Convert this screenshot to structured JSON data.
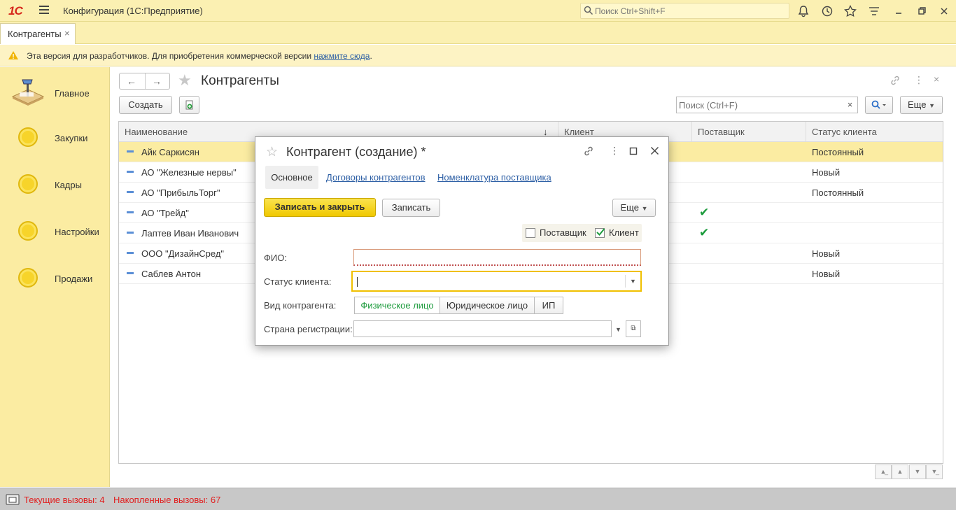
{
  "app": {
    "logo": "1С",
    "title": "Конфигурация  (1С:Предприятие)",
    "search_placeholder": "Поиск Ctrl+Shift+F"
  },
  "tabs": [
    {
      "label": "Контрагенты",
      "close": "×"
    }
  ],
  "warning": {
    "text": "Эта версия для разработчиков. Для приобретения коммерческой версии ",
    "link": "нажмите сюда",
    "suffix": "."
  },
  "sidebar": {
    "items": [
      {
        "label": "Главное",
        "icon": "desk-lamp-icon"
      },
      {
        "label": "Закупки",
        "icon": "yellow-circle-icon"
      },
      {
        "label": "Кадры",
        "icon": "yellow-circle-icon"
      },
      {
        "label": "Настройки",
        "icon": "yellow-circle-icon"
      },
      {
        "label": "Продажи",
        "icon": "yellow-circle-icon"
      }
    ]
  },
  "main": {
    "title": "Контрагенты",
    "create_label": "Создать",
    "search_placeholder": "Поиск (Ctrl+F)",
    "clear_label": "×",
    "more_label": "Еще",
    "columns": [
      "Наименование",
      "Клиент",
      "Поставщик",
      "Статус клиента"
    ],
    "sort_indicator": "↓",
    "rows": [
      {
        "name": "Айк Саркисян",
        "supplier": false,
        "status": "Постоянный",
        "selected": true
      },
      {
        "name": "АО \"Железные нервы\"",
        "supplier": false,
        "status": "Новый"
      },
      {
        "name": "АО \"ПрибыльТорг\"",
        "supplier": false,
        "status": "Постоянный"
      },
      {
        "name": "АО \"Трейд\"",
        "supplier": true,
        "status": ""
      },
      {
        "name": "Лаптев Иван Иванович",
        "supplier": true,
        "status": ""
      },
      {
        "name": "ООО \"ДизайнСред\"",
        "supplier": false,
        "status": "Новый"
      },
      {
        "name": "Саблев Антон",
        "supplier": false,
        "status": "Новый"
      }
    ]
  },
  "dialog": {
    "title": "Контрагент (создание) *",
    "tabs": [
      "Основное",
      "Договоры контрагентов",
      "Номенклатура поставщика"
    ],
    "save_close_label": "Записать и закрыть",
    "save_label": "Записать",
    "more_label": "Еще",
    "supplier_label": "Поставщик",
    "supplier_checked": false,
    "client_label": "Клиент",
    "client_checked": true,
    "fio_label": "ФИО:",
    "fio_value": "",
    "status_label": "Статус клиента:",
    "status_value": "",
    "vid_label": "Вид контрагента:",
    "vid_options": [
      "Физическое лицо",
      "Юридическое лицо",
      "ИП"
    ],
    "vid_selected": "Физическое лицо",
    "country_label": "Страна регистрации:",
    "country_value": ""
  },
  "statusbar": {
    "current_calls": "Текущие вызовы: 4",
    "accumulated_calls": "Накопленные вызовы: 67"
  },
  "colors": {
    "accent_yellow": "#fbf0b2",
    "link": "#2d5fa5",
    "check_green": "#1c9b3c",
    "status_red": "#e02020"
  }
}
